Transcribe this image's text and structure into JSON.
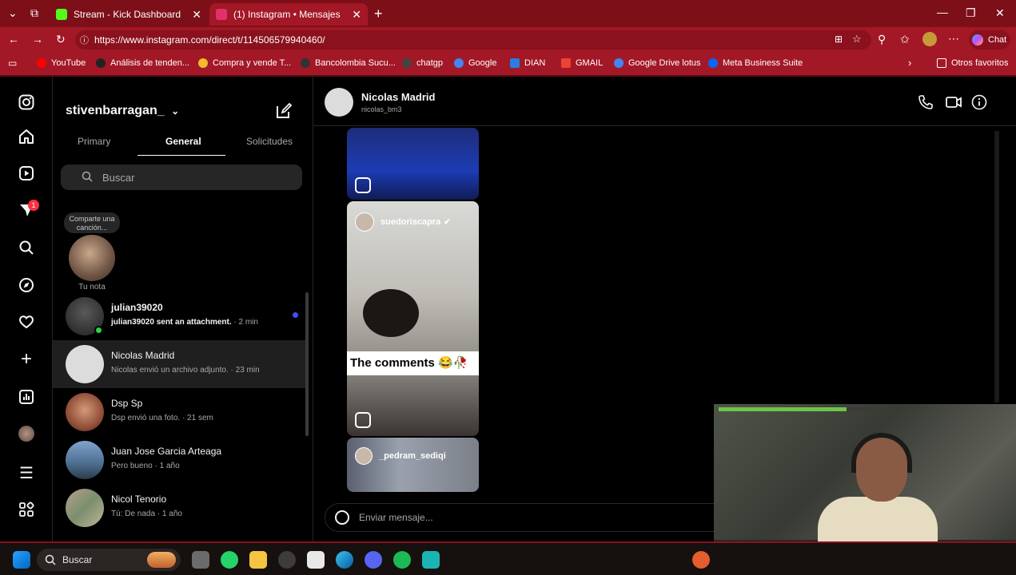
{
  "browser": {
    "tabs": [
      {
        "title": "Stream - Kick Dashboard",
        "favicon_color": "#53fc18"
      },
      {
        "title": "(1) Instagram • Mensajes",
        "favicon_color": "#e1306c"
      }
    ],
    "url": "https://www.instagram.com/direct/t/114506579940460/",
    "chat_label": "Chat",
    "bookmarks": [
      {
        "label": "YouTube",
        "color": "#ff0000"
      },
      {
        "label": "Análisis de tenden...",
        "color": "#222222"
      },
      {
        "label": "Compra y vende T...",
        "color": "#f3ba2f"
      },
      {
        "label": "Bancolombia Sucu...",
        "color": "#333333"
      },
      {
        "label": "chatgp",
        "color": "#444444"
      },
      {
        "label": "Google",
        "color": "#4285f4"
      },
      {
        "label": "DIAN",
        "color": "#2a7de1"
      },
      {
        "label": "GMAIL",
        "color": "#ea4335"
      },
      {
        "label": "Google Drive lotus",
        "color": "#4285f4"
      },
      {
        "label": "Meta Business Suite",
        "color": "#0866ff"
      }
    ],
    "other_favorites": "Otros favoritos"
  },
  "inbox": {
    "username": "stivenbarragan_",
    "tabs": [
      "Primary",
      "General",
      "Solicitudes"
    ],
    "active_tab": "General",
    "search_placeholder": "Buscar",
    "note": {
      "bubble": "Comparte una canción...",
      "label": "Tu nota"
    },
    "threads": [
      {
        "name": "julian39020",
        "preview": "julian39020 sent an attachment.",
        "time": "· 2 min",
        "unread": true,
        "online": true,
        "avatar_color": "#3a3a3a"
      },
      {
        "name": "Nicolas Madrid",
        "preview": "Nicolas envió un archivo adjunto.",
        "time": "· 23 min",
        "unread": false,
        "selected": true,
        "avatar_color": "#dcdcdc"
      },
      {
        "name": "Dsp Sp",
        "preview": "Dsp envió una foto.",
        "time": "· 21 sem",
        "unread": false,
        "avatar_color": "#c17a5a"
      },
      {
        "name": "Juan Jose Garcia Arteaga",
        "preview": "Pero bueno",
        "time": "· 1 año",
        "unread": false,
        "avatar_color": "#6a8fb5"
      },
      {
        "name": "Nicol Tenorio",
        "preview": "Tú: De nada",
        "time": "· 1 año",
        "unread": false,
        "avatar_color": "#a38c7a"
      }
    ]
  },
  "rail": {
    "notification_count": "1"
  },
  "conversation": {
    "name": "Nicolas Madrid",
    "handle": "nicolas_bm3",
    "reels": [
      {
        "user": "",
        "caption": ""
      },
      {
        "user": "suedoriscapra",
        "caption": "The comments 😂🥀"
      },
      {
        "user": "_pedram_sediqi",
        "caption": ""
      }
    ],
    "input_placeholder": "Enviar mensaje..."
  },
  "taskbar": {
    "search_label": "Buscar"
  }
}
